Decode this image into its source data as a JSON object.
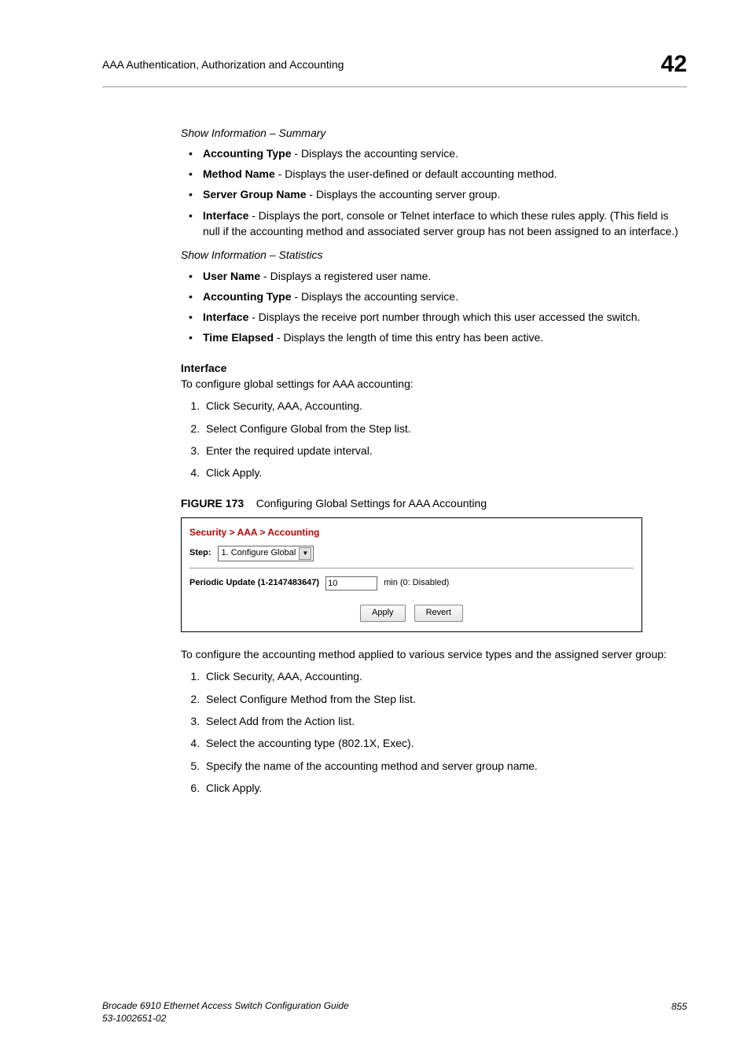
{
  "header": {
    "title": "AAA Authentication, Authorization and Accounting",
    "chapter": "42"
  },
  "section_summary_title": "Show Information – Summary",
  "summary_items": [
    {
      "term": "Accounting Type",
      "desc": " - Displays the accounting service."
    },
    {
      "term": "Method Name",
      "desc": " - Displays the user-defined or default accounting method."
    },
    {
      "term": "Server Group Name",
      "desc": " - Displays the accounting server group."
    },
    {
      "term": "Interface",
      "desc": " - Displays the port, console or Telnet interface to which these rules apply. (This field is null if the accounting method and associated server group has not been assigned to an interface.)"
    }
  ],
  "section_stats_title": "Show Information – Statistics",
  "stats_items": [
    {
      "term": "User Name",
      "desc": " - Displays a registered user name."
    },
    {
      "term": "Accounting Type",
      "desc": " - Displays the accounting service."
    },
    {
      "term": "Interface",
      "desc": " - Displays the receive port number through which this user accessed the switch."
    },
    {
      "term": "Time Elapsed",
      "desc": " - Displays the length of time this entry has been active."
    }
  ],
  "interface_heading": "Interface",
  "interface_intro": "To configure global settings for AAA accounting:",
  "interface_steps": [
    "Click Security, AAA, Accounting.",
    "Select Configure Global from the Step list.",
    "Enter the required update interval.",
    "Click Apply."
  ],
  "figure": {
    "label": "FIGURE 173",
    "caption": "Configuring Global Settings for AAA Accounting"
  },
  "screenshot": {
    "breadcrumb": "Security > AAA > Accounting",
    "step_label": "Step:",
    "step_value": "1. Configure Global",
    "field_label": "Periodic Update (1-2147483647)",
    "field_value": "10",
    "field_hint": "min (0: Disabled)",
    "apply": "Apply",
    "revert": "Revert"
  },
  "method_intro": "To configure the accounting method applied to various service types and the assigned server group:",
  "method_steps": [
    "Click Security, AAA, Accounting.",
    "Select Configure Method from the Step list.",
    "Select Add from the Action list.",
    "Select the accounting type (802.1X, Exec).",
    "Specify the name of the accounting method and server group name.",
    "Click Apply."
  ],
  "footer": {
    "line1": "Brocade 6910 Ethernet Access Switch Configuration Guide",
    "line2": "53-1002651-02",
    "page": "855"
  }
}
